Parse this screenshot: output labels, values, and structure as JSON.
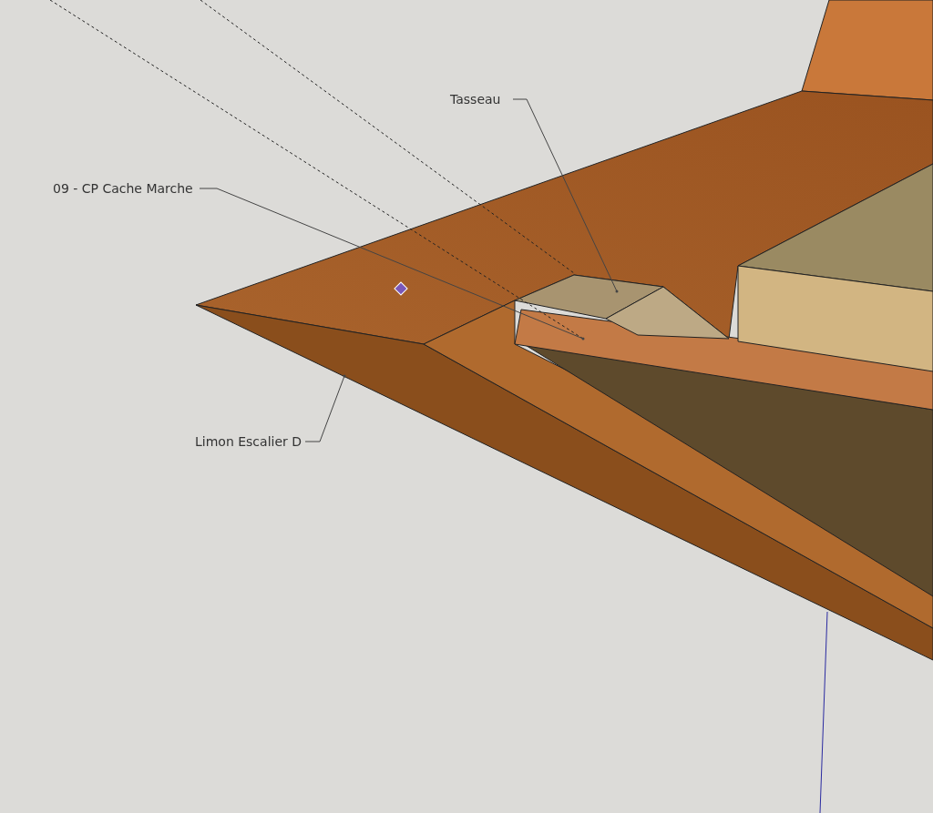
{
  "labels": [
    {
      "text": "Tasseau"
    },
    {
      "text": "09 - CP Cache Marche"
    },
    {
      "text": "Limon Escalier D"
    }
  ]
}
